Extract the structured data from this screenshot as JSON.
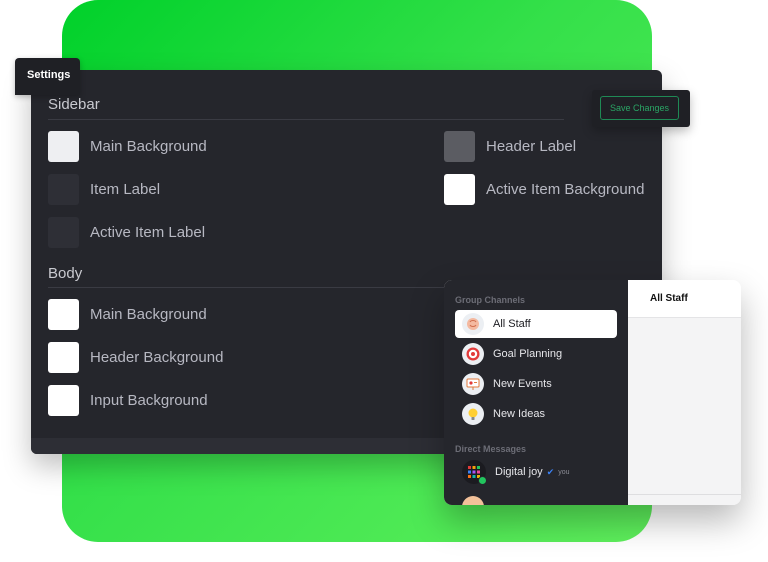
{
  "settings_tab": {
    "label": "Settings"
  },
  "save_button": {
    "label": "Save Changes"
  },
  "sidebar_section": {
    "title": "Sidebar",
    "items": [
      {
        "label": "Main Background",
        "swatch_color": "#eeeff2"
      },
      {
        "label": "Item Label",
        "swatch_color": "#2e2f36"
      },
      {
        "label": "Active Item Label",
        "swatch_color": "#2e2f36"
      },
      {
        "label": "Header Label",
        "swatch_color": "#5b5c62"
      },
      {
        "label": "Active Item Background",
        "swatch_color": "#ffffff"
      }
    ]
  },
  "body_section": {
    "title": "Body",
    "items": [
      {
        "label": "Main Background",
        "swatch_color": "#ffffff"
      },
      {
        "label": "Header Background",
        "swatch_color": "#ffffff"
      },
      {
        "label": "Input Background",
        "swatch_color": "#ffffff"
      }
    ]
  },
  "chat_preview": {
    "group_channels_title": "Group Channels",
    "channels": [
      {
        "label": "All Staff",
        "icon": "brain-icon",
        "active": true
      },
      {
        "label": "Goal Planning",
        "icon": "target-icon",
        "active": false
      },
      {
        "label": "New Events",
        "icon": "presentation-icon",
        "active": false
      },
      {
        "label": "New Ideas",
        "icon": "lightbulb-icon",
        "active": false
      }
    ],
    "direct_messages_title": "Direct Messages",
    "dm": {
      "name": "Digital joy",
      "tag": "you",
      "icon": "verified-icon"
    },
    "main_header": "All Staff"
  },
  "colors": {
    "green_accent": "#22c55e",
    "panel_bg": "#25262c",
    "save_border": "#1f8a55"
  }
}
